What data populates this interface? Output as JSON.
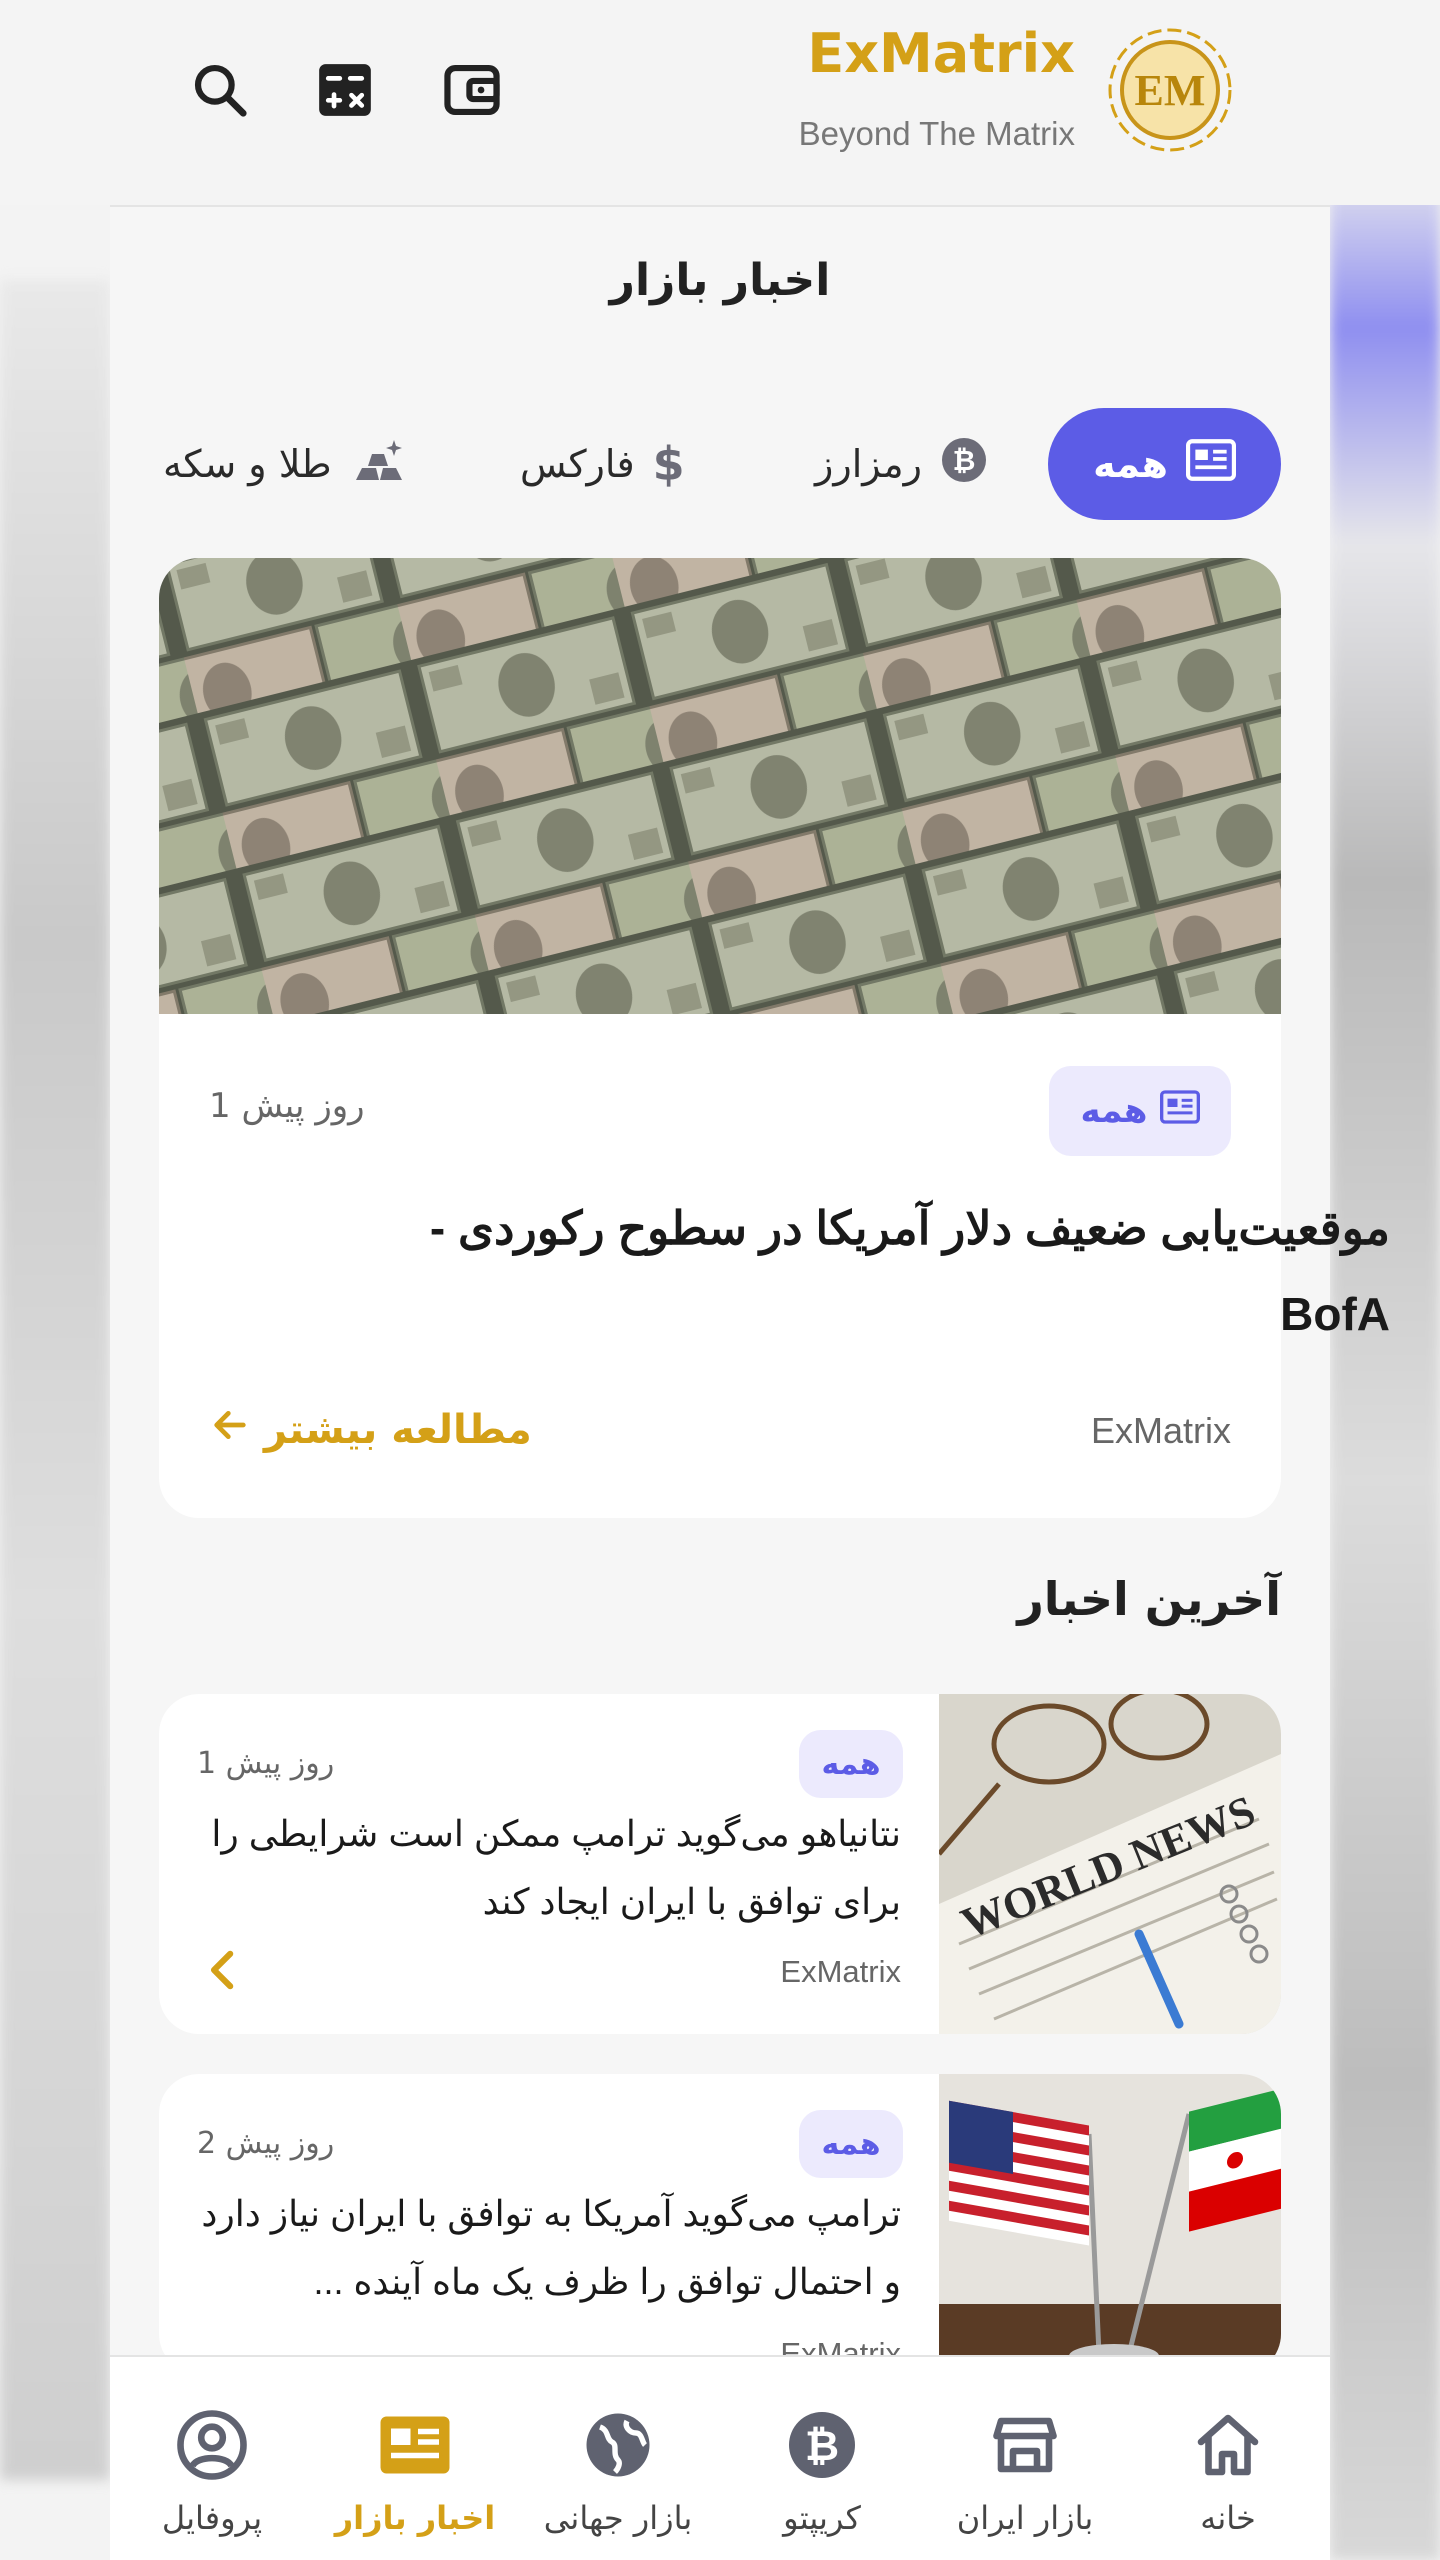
{
  "brand": {
    "name": "ExMatrix",
    "tagline": "Beyond The Matrix",
    "logo_text": "EM",
    "accent": "#d4a017",
    "primary": "#5c5ce6"
  },
  "header_icons": [
    "search-icon",
    "calculator-icon",
    "wallet-icon"
  ],
  "page": {
    "title": "اخبار بازار"
  },
  "filters": [
    {
      "label": "همه",
      "icon": "news-icon",
      "active": true
    },
    {
      "label": "رمزارز",
      "icon": "bitcoin-icon"
    },
    {
      "label": "فارکس",
      "icon": "dollar-icon"
    },
    {
      "label": "طلا و سکه",
      "icon": "gold-bars-icon"
    }
  ],
  "featured": {
    "category": "همه",
    "time": "1 روز پیش",
    "title": "موقعیت‌یابی ضعیف دلار آمریکا در سطوح رکوردی - BofA",
    "source": "ExMatrix",
    "read_more": "مطالعه بیشتر",
    "image": "dollar-bills-photo"
  },
  "latest": {
    "title": "آخرین اخبار",
    "items": [
      {
        "category": "همه",
        "time": "1 روز پیش",
        "title": "نتانیاهو می‌گوید ترامپ ممکن است شرایطی را برای توافق با ایران ایجاد کند",
        "source": "ExMatrix",
        "image": "world-news-newspaper-photo"
      },
      {
        "category": "همه",
        "time": "2 روز پیش",
        "title": "ترامپ می‌گوید آمریکا به توافق با ایران نیاز دارد و احتمال توافق را ظرف یک ماه آینده ...",
        "source": "ExMatrix",
        "image": "us-iran-flags-photo"
      }
    ]
  },
  "nav": [
    {
      "label": "خانه",
      "icon": "home-icon"
    },
    {
      "label": "بازار ایران",
      "icon": "store-icon"
    },
    {
      "label": "کریپتو",
      "icon": "bitcoin-icon"
    },
    {
      "label": "بازار جهانی",
      "icon": "globe-icon"
    },
    {
      "label": "اخبار بازار",
      "icon": "newspaper-icon",
      "active": true
    },
    {
      "label": "پروفایل",
      "icon": "profile-icon"
    }
  ]
}
